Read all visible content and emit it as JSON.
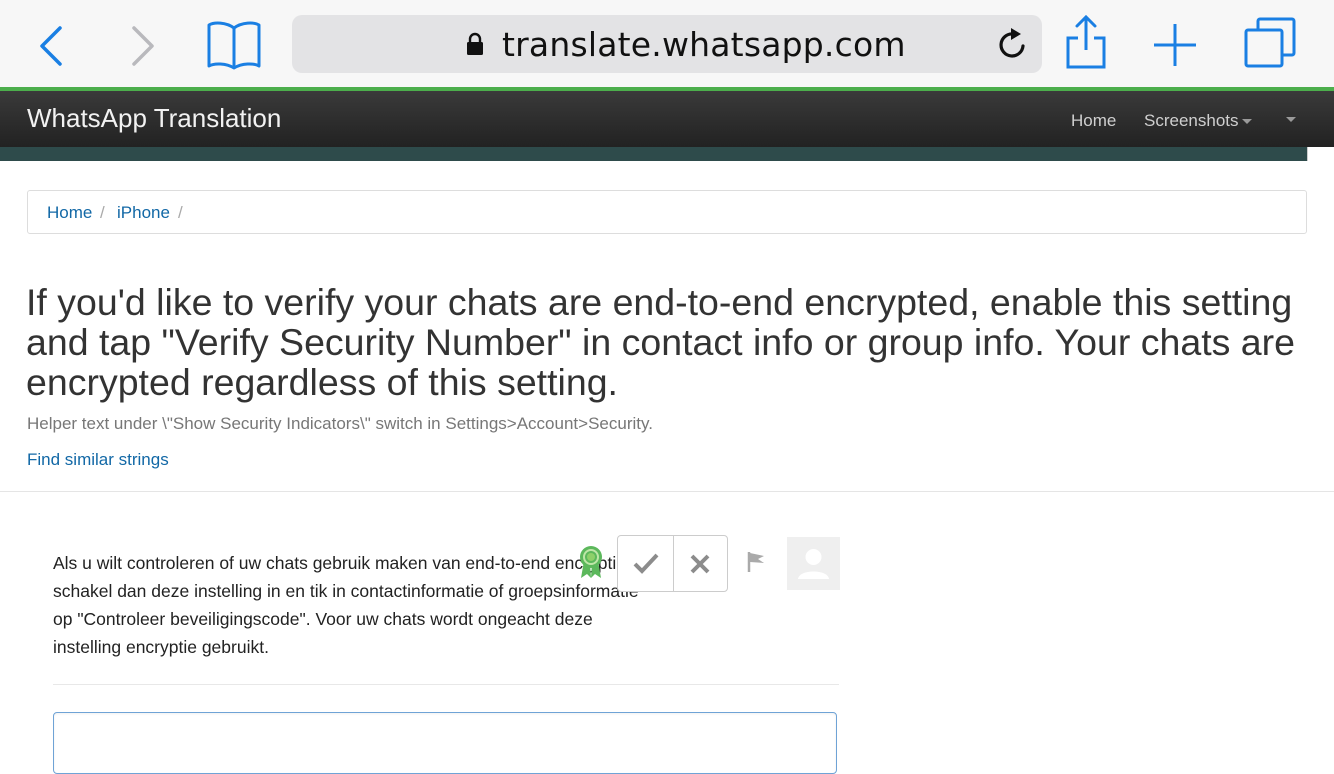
{
  "browser": {
    "url": "translate.whatsapp.com",
    "accent_color": "#1a7fe3"
  },
  "navbar": {
    "brand": "WhatsApp Translation",
    "items": [
      {
        "label": "Home"
      },
      {
        "label": "Screenshots"
      }
    ]
  },
  "breadcrumb": {
    "items": [
      {
        "label": "Home"
      },
      {
        "label": "iPhone"
      }
    ],
    "separator": "/"
  },
  "string": {
    "source": "If you'd like to verify your chats are end-to-end encrypted, enable this setting and tap \"Verify Security Number\" in contact info or group info. Your chats are encrypted regardless of this setting.",
    "helper": "Helper text under \\\"Show Security Indicators\\\" switch in Settings>Account>Security.",
    "find_similar": "Find similar strings"
  },
  "translation": {
    "text": "Als u wilt controleren of uw chats gebruik maken van end-to-end encryptie, schakel dan deze instelling in en tik in contactinformatie of groepsinformatie op \"Controleer beveiligingscode\". Voor uw chats wordt ongeacht deze instelling encryptie gebruikt.",
    "badge_color": "#5cb85c"
  }
}
